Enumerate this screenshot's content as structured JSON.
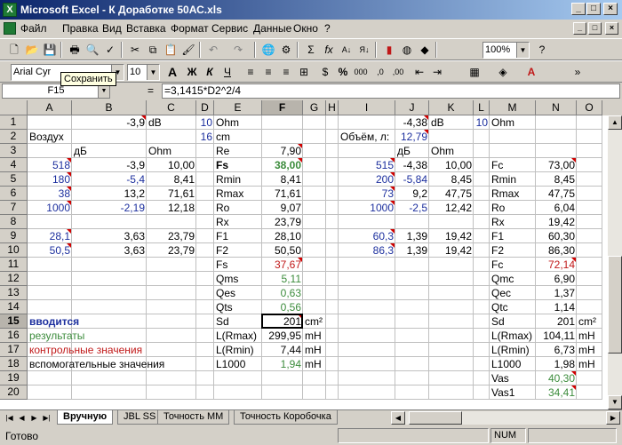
{
  "window": {
    "title": "Microsoft Excel - К Доработке 50АС.xls"
  },
  "menu": [
    "Файл",
    "Правка",
    "Вид",
    "Вставка",
    "Формат",
    "Сервис",
    "Данные",
    "Окно",
    "?"
  ],
  "toolbar": {
    "zoom": "100%",
    "font_name": "Arial Cyr",
    "font_size": "10",
    "tooltip": "Сохранить"
  },
  "formula_bar": {
    "name_box": "F15",
    "eq": "=",
    "formula": "=3,1415*D2^2/4"
  },
  "columns": [
    "A",
    "B",
    "C",
    "D",
    "E",
    "F",
    "G",
    "H",
    "I",
    "J",
    "K",
    "L",
    "M",
    "N",
    "O"
  ],
  "rows": [
    "1",
    "2",
    "3",
    "4",
    "5",
    "6",
    "7",
    "8",
    "9",
    "10",
    "11",
    "12",
    "13",
    "14",
    "15",
    "16",
    "17",
    "18",
    "19",
    "20"
  ],
  "cells": {
    "B1": "-3,9",
    "C1": "dB",
    "D1": "10",
    "E1": "Ohm",
    "J1": "-4,38",
    "K1": "dB",
    "L1": "10",
    "M1": "Ohm",
    "A2": "Воздух",
    "D2": "16",
    "E2": "cm",
    "I2": "Объём, л:",
    "J2": "12,79",
    "B3": "дБ",
    "C3": "Ohm",
    "E3": "Re",
    "F3": "7,90",
    "J3": "дБ",
    "K3": "Ohm",
    "A4": "518",
    "B4": "-3,9",
    "C4": "10,00",
    "E4": "Fs",
    "F4": "38,00",
    "I4": "515",
    "J4": "-4,38",
    "K4": "10,00",
    "M4": "Fc",
    "N4": "73,00",
    "A5": "180",
    "B5": "-5,4",
    "C5": "8,41",
    "E5": "Rmin",
    "F5": "8,41",
    "I5": "200",
    "J5": "-5,84",
    "K5": "8,45",
    "M5": "Rmin",
    "N5": "8,45",
    "A6": "38",
    "B6": "13,2",
    "C6": "71,61",
    "E6": "Rmax",
    "F6": "71,61",
    "I6": "73",
    "J6": "9,2",
    "K6": "47,75",
    "M6": "Rmax",
    "N6": "47,75",
    "A7": "1000",
    "B7": "-2,19",
    "C7": "12,18",
    "E7": "Ro",
    "F7": "9,07",
    "I7": "1000",
    "J7": "-2,5",
    "K7": "12,42",
    "M7": "Ro",
    "N7": "6,04",
    "E8": "Rx",
    "F8": "23,79",
    "M8": "Rx",
    "N8": "19,42",
    "A9": "28,1",
    "B9": "3,63",
    "C9": "23,79",
    "E9": "F1",
    "F9": "28,10",
    "I9": "60,3",
    "J9": "1,39",
    "K9": "19,42",
    "M9": "F1",
    "N9": "60,30",
    "A10": "50,5",
    "B10": "3,63",
    "C10": "23,79",
    "E10": "F2",
    "F10": "50,50",
    "I10": "86,3",
    "J10": "1,39",
    "K10": "19,42",
    "M10": "F2",
    "N10": "86,30",
    "E11": "Fs",
    "F11": "37,67",
    "M11": "Fc",
    "N11": "72,14",
    "E12": "Qms",
    "F12": "5,11",
    "M12": "Qmc",
    "N12": "6,90",
    "E13": "Qes",
    "F13": "0,63",
    "M13": "Qec",
    "N13": "1,37",
    "E14": "Qts",
    "F14": "0,56",
    "M14": "Qtc",
    "N14": "1,14",
    "A15": "вводится",
    "E15": "Sd",
    "F15": "201",
    "G15": "cm²",
    "M15": "Sd",
    "N15": "201",
    "O15": "cm²",
    "A16": "результаты",
    "E16": "L(Rmax)",
    "F16": "299,95",
    "G16": "mH",
    "M16": "L(Rmax)",
    "N16": "104,11",
    "O16": "mH",
    "A17": "контрольные значения",
    "E17": "L(Rmin)",
    "F17": "7,44",
    "G17": "mH",
    "M17": "L(Rmin)",
    "N17": "6,73",
    "O17": "mH",
    "A18": "вспомогательные значения",
    "E18": "L1000",
    "F18": "1,94",
    "G18": "mH",
    "M18": "L1000",
    "N18": "1,98",
    "O18": "mH",
    "M19": "Vas",
    "N19": "40,30",
    "M20": "Vas1",
    "N20": "34,41"
  },
  "sheet_tabs": [
    "Вручную",
    "JBL SS",
    "Точность ММ",
    "Точность Коробочка"
  ],
  "status": {
    "text": "Готово",
    "num": "NUM"
  },
  "colors": {
    "input": "#1c2f9e",
    "result": "#3c8c3c",
    "control": "#c01818",
    "comment": "#d00000"
  }
}
